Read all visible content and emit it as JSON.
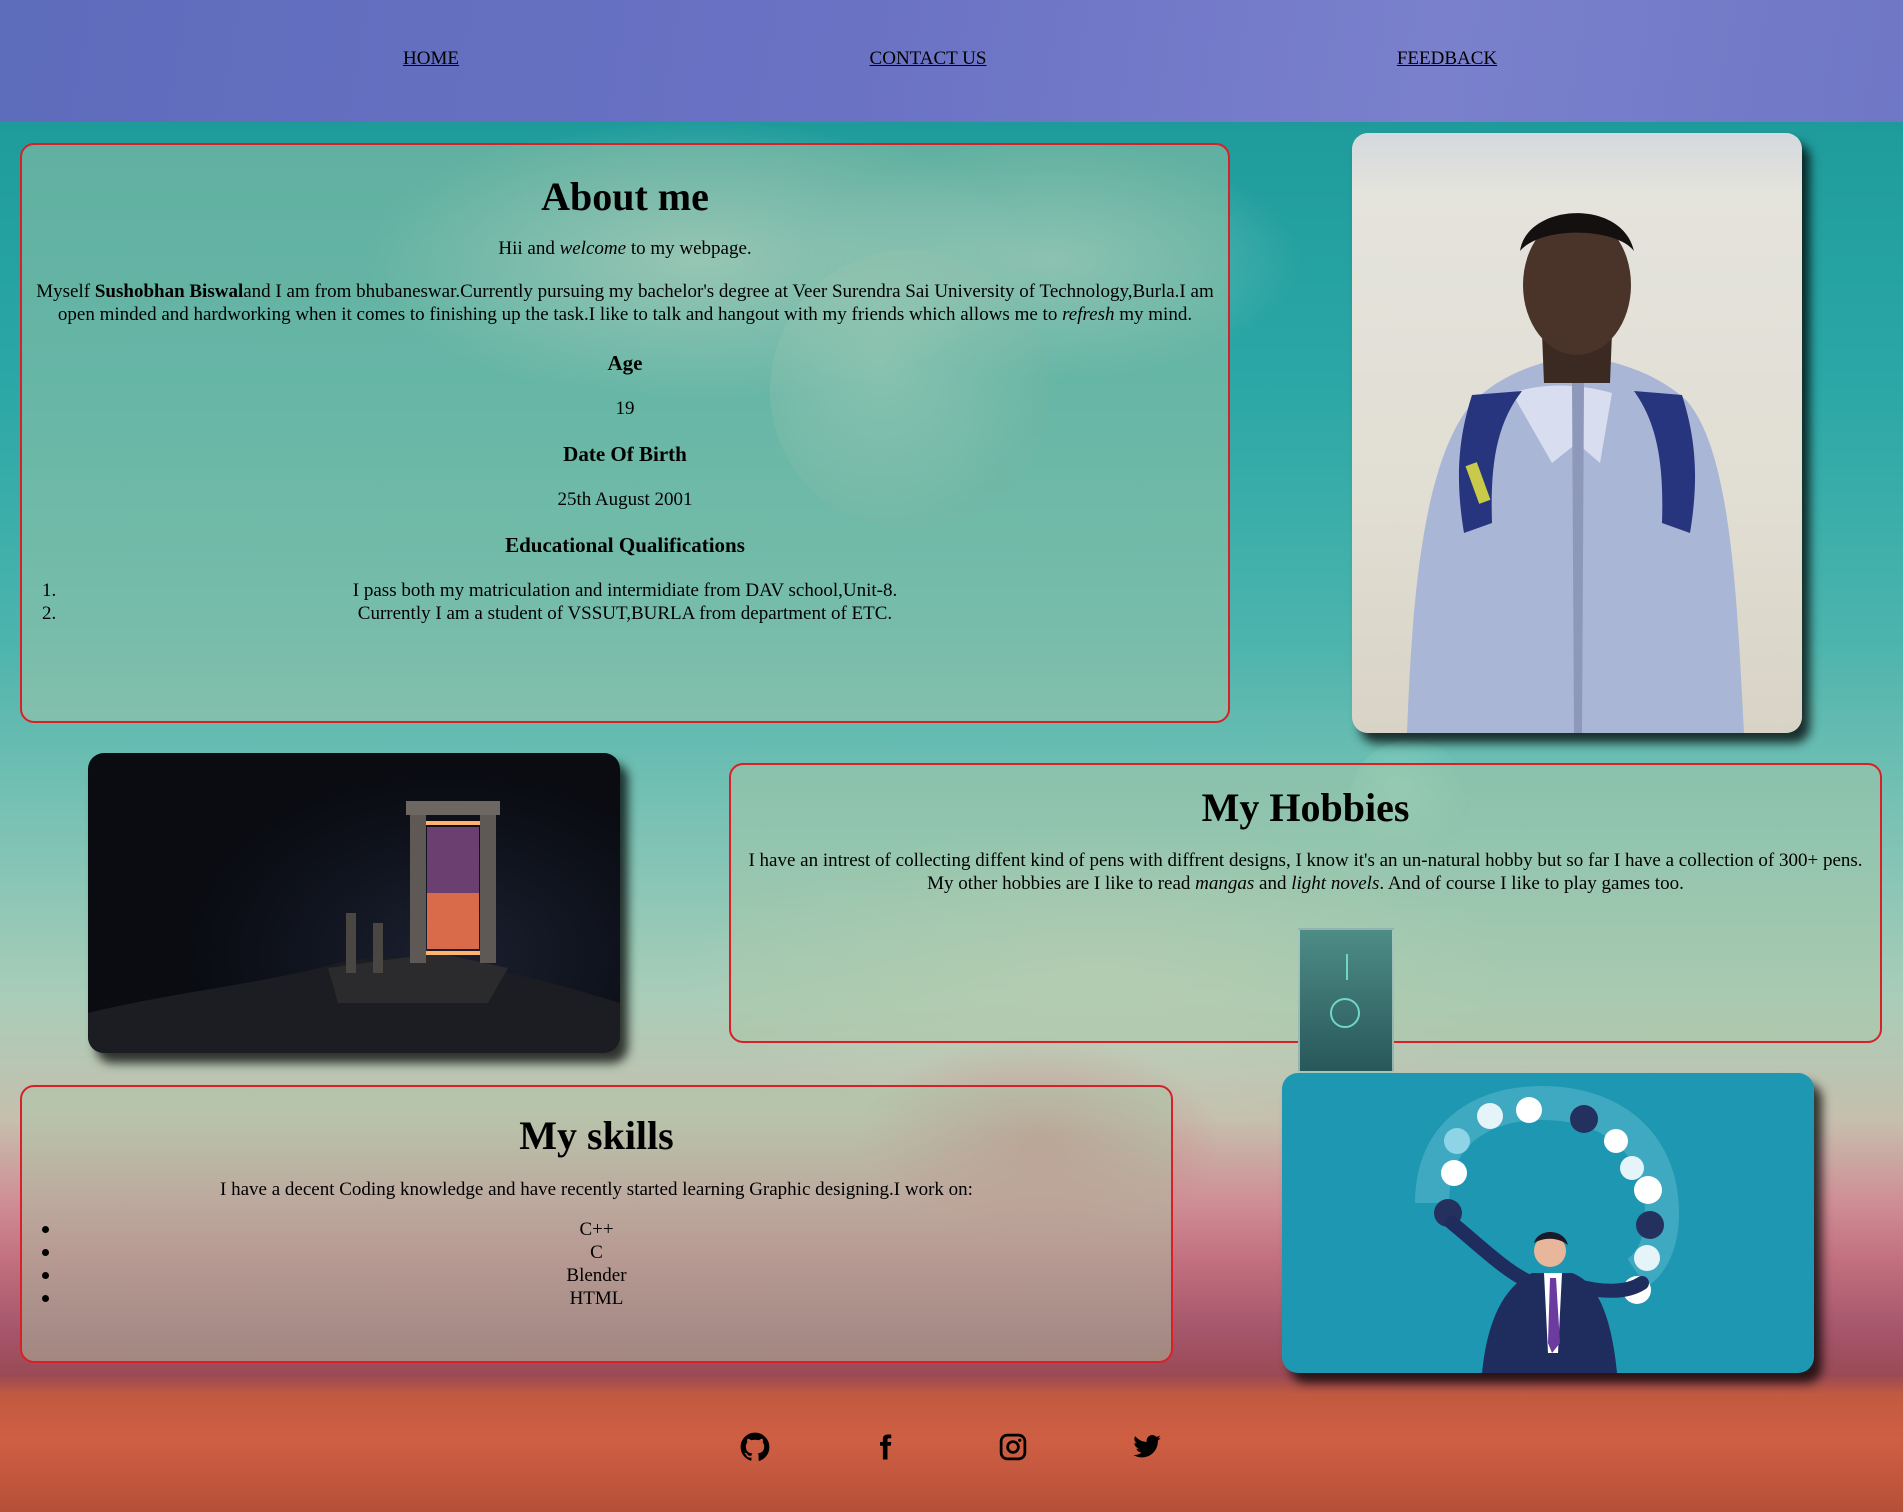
{
  "nav": {
    "home": "HOME",
    "contact": "CONTACT US",
    "feedback": "FEEDBACK"
  },
  "about": {
    "title": "About me",
    "greeting_pre": "Hii and ",
    "greeting_em": "welcome",
    "greeting_post": " to my webpage.",
    "intro_pre": "Myself ",
    "name": "Sushobhan Biswal",
    "intro_mid": "and I am from bhubaneswar.Currently pursuing my bachelor's degree at Veer Surendra Sai University of Technology,Burla.I am open minded and hardworking when it comes to finishing up the task.I like to talk and hangout with my friends which allows me to ",
    "intro_em": "refresh",
    "intro_post": " my mind.",
    "age_heading": "Age",
    "age": "19",
    "dob_heading": "Date Of Birth",
    "dob": "25th August 2001",
    "edu_heading": "Educational Qualifications",
    "edu": [
      {
        "marker": "1.",
        "text": "I pass both my matriculation and intermidiate from DAV school,Unit-8."
      },
      {
        "marker": "2.",
        "text": "Currently I am a student of VSSUT,BURLA from department of ETC."
      }
    ]
  },
  "hobbies": {
    "title": "My Hobbies",
    "text_pre": "I have an intrest of collecting diffent kind of pens with diffrent designs, I know it's an un-natural hobby but so far I have a collection of 300+ pens. My other hobbies are I like to read ",
    "em1": "mangas",
    "text_mid": " and ",
    "em2": "light novels",
    "text_post": ". And of course I like to play games too."
  },
  "skills": {
    "title": "My skills",
    "intro": "I have a decent Coding knowledge and have recently started learning Graphic designing.I work on:",
    "items": [
      "C++",
      "C",
      "Blender",
      "HTML"
    ]
  },
  "footer": {
    "icons": [
      "github-icon",
      "facebook-icon",
      "instagram-icon",
      "twitter-icon"
    ]
  },
  "colors": {
    "nav_bg": "#6a72c4",
    "card_border": "#d92026",
    "illustration_bg": "#1e97b2"
  }
}
